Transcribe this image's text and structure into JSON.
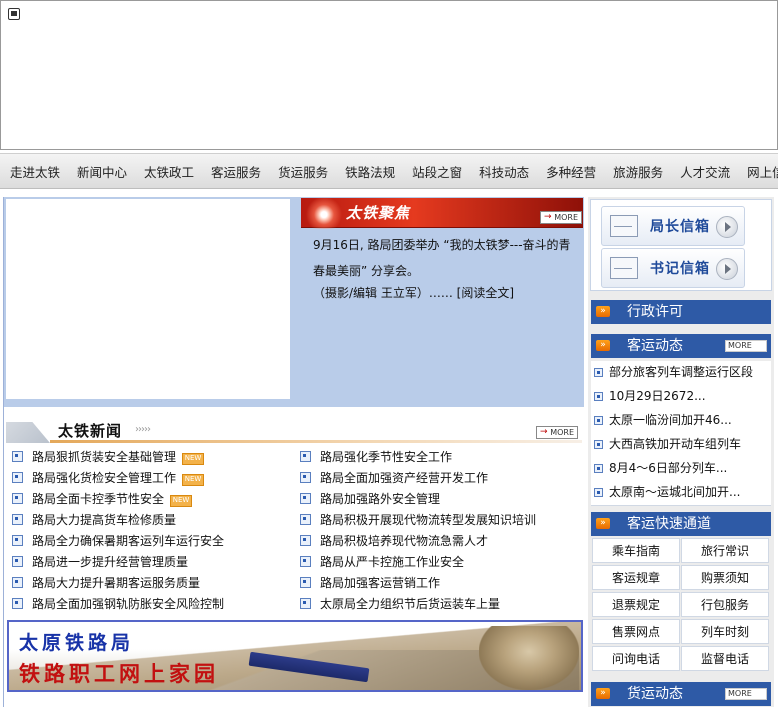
{
  "nav": [
    "走进太铁",
    "新闻中心",
    "太铁政工",
    "客运服务",
    "货运服务",
    "铁路法规",
    "站段之窗",
    "科技动态",
    "多种经营",
    "旅游服务",
    "人才交流",
    "网上信访"
  ],
  "focus": {
    "title": "太铁聚焦",
    "more": "MORE",
    "text": "9月16日, 路局团委举办 “我的太铁梦---奋斗的青春最美丽” 分享会。",
    "credit": "（摄影/编辑  王立军）…… [阅读全文]"
  },
  "news": {
    "title": "太铁新闻",
    "deco": "›››››",
    "more": "MORE",
    "new_tag": "NEW",
    "left": [
      {
        "text": "路局狠抓货装安全基础管理",
        "isnew": true
      },
      {
        "text": "路局强化货检安全管理工作",
        "isnew": true
      },
      {
        "text": "路局全面卡控季节性安全",
        "isnew": true
      },
      {
        "text": "路局大力提高货车检修质量",
        "isnew": false
      },
      {
        "text": "路局全力确保暑期客运列车运行安全",
        "isnew": false
      },
      {
        "text": "路局进一步提升经营管理质量",
        "isnew": false
      },
      {
        "text": "路局大力提升暑期客运服务质量",
        "isnew": false
      },
      {
        "text": "路局全面加强钢轨防胀安全风险控制",
        "isnew": false
      }
    ],
    "right": [
      {
        "text": "路局强化季节性安全工作"
      },
      {
        "text": "路局全面加强资产经营开发工作"
      },
      {
        "text": "路局加强路外安全管理"
      },
      {
        "text": "路局积极开展现代物流转型发展知识培训"
      },
      {
        "text": "路局积极培养现代物流急需人才"
      },
      {
        "text": "路局从严卡控施工作业安全"
      },
      {
        "text": "路局加强客运营销工作"
      },
      {
        "text": "太原局全力组织节后货运装车上量"
      }
    ]
  },
  "banner": {
    "line1": "太原铁路局",
    "line2": "铁路职工网上家园"
  },
  "mail": [
    "局长信箱",
    "书记信箱"
  ],
  "sidebar": {
    "admin": "行政许可",
    "passenger_news": {
      "title": "客运动态",
      "more": "MORE",
      "items": [
        "部分旅客列车调整运行区段",
        "10月29日2672...",
        "太原一临汾间加开46...",
        "大西高铁加开动车组列车",
        "8月4～6日部分列车...",
        "太原南～运城北间加开..."
      ]
    },
    "quick": {
      "title": "客运快速通道",
      "cells": [
        "乘车指南",
        "旅行常识",
        "客运规章",
        "购票须知",
        "退票规定",
        "行包服务",
        "售票网点",
        "列车时刻",
        "问询电话",
        "监督电话"
      ]
    },
    "freight": {
      "title": "货运动态",
      "more": "MORE"
    }
  },
  "icon_symbol": "»"
}
